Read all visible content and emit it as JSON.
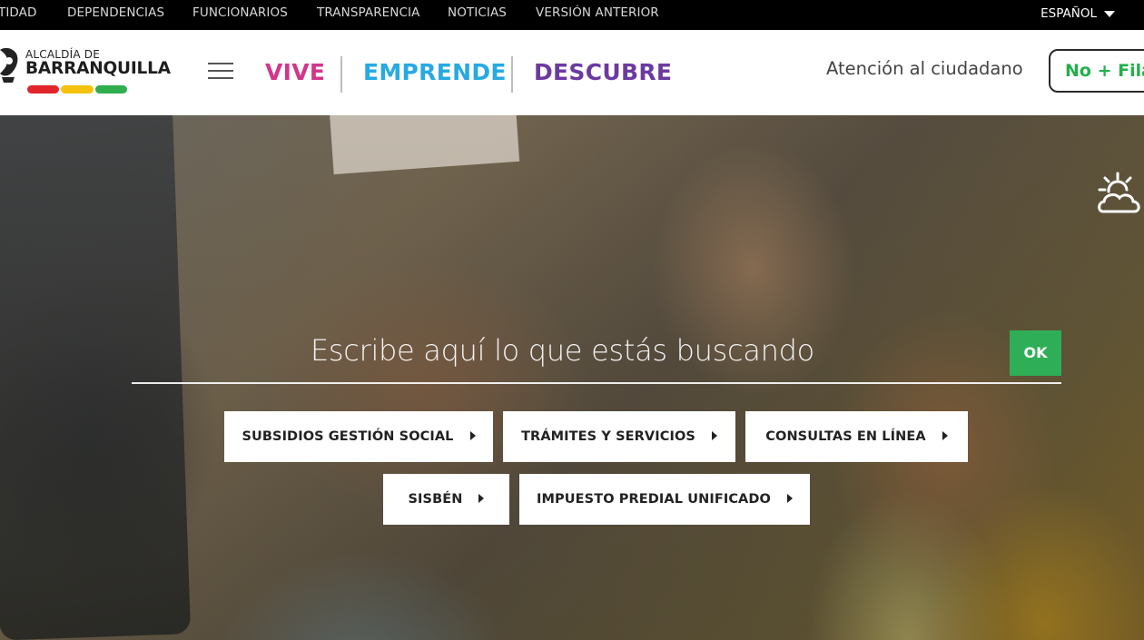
{
  "topbar": {
    "links": [
      "TIDAD",
      "DEPENDENCIAS",
      "FUNCIONARIOS",
      "TRANSPARENCIA",
      "NOTICIAS",
      "VERSIÓN ANTERIOR"
    ],
    "language": "ESPAÑOL"
  },
  "header": {
    "logo_small": "ALCALDÍA DE",
    "logo_big": "BARRANQUILLA",
    "flag_colors": [
      "#e2242b",
      "#f4c20d",
      "#2fae4f"
    ],
    "nav": [
      {
        "label": "VIVE",
        "color": "#d2368b"
      },
      {
        "label": "EMPRENDE",
        "color": "#27a9e1"
      },
      {
        "label": "DESCUBRE",
        "color": "#6b3aa0"
      }
    ],
    "atencion": "Atención al ciudadano",
    "cta": "No + Filas"
  },
  "hero": {
    "search_placeholder": "Escribe aquí lo que estás buscando",
    "search_button": "OK",
    "quick_links_row1": [
      "SUBSIDIOS GESTIÓN SOCIAL",
      "TRÁMITES Y SERVICIOS",
      "CONSULTAS EN LÍNEA"
    ],
    "quick_links_row2": [
      "SISBÉN",
      "IMPUESTO PREDIAL UNIFICADO"
    ],
    "weather_icon": "partly-cloudy-icon"
  },
  "colors": {
    "ok_green": "#2eaf57",
    "cta_green": "#22b04b"
  }
}
